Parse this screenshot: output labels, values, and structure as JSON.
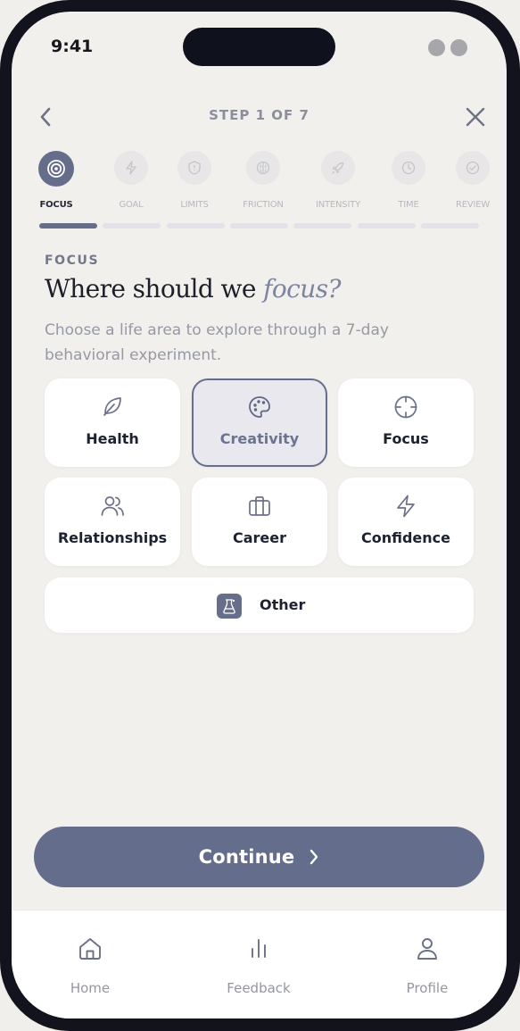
{
  "status_bar": {
    "time": "9:41"
  },
  "header": {
    "step_title": "STEP 1 OF 7"
  },
  "stepper": {
    "steps": [
      {
        "label": "FOCUS",
        "icon": "target-icon",
        "active": true
      },
      {
        "label": "GOAL",
        "icon": "bolt-icon",
        "active": false
      },
      {
        "label": "LIMITS",
        "icon": "shield-icon",
        "active": false
      },
      {
        "label": "FRICTION",
        "icon": "brain-icon",
        "active": false
      },
      {
        "label": "INTENSITY",
        "icon": "rocket-icon",
        "active": false
      },
      {
        "label": "TIME",
        "icon": "clock-icon",
        "active": false
      },
      {
        "label": "REVIEW",
        "icon": "check-circle-icon",
        "active": false
      }
    ],
    "progress": "1 of 7"
  },
  "content": {
    "eyebrow": "FOCUS",
    "heading_plain": "Where should we ",
    "heading_emphasis": "focus?",
    "subtitle": "Choose a life area to explore through a 7-day behavioral experiment."
  },
  "options": [
    {
      "label": "Health",
      "icon": "leaf-icon",
      "selected": false
    },
    {
      "label": "Creativity",
      "icon": "palette-icon",
      "selected": true
    },
    {
      "label": "Focus",
      "icon": "crosshair-icon",
      "selected": false
    },
    {
      "label": "Relationships",
      "icon": "users-icon",
      "selected": false
    },
    {
      "label": "Career",
      "icon": "briefcase-icon",
      "selected": false
    },
    {
      "label": "Confidence",
      "icon": "bolt-icon",
      "selected": false
    }
  ],
  "other_option": {
    "label": "Other",
    "icon": "flask-icon"
  },
  "primary_action": {
    "label": "Continue"
  },
  "tab_bar": {
    "items": [
      {
        "label": "Home",
        "icon": "home-icon"
      },
      {
        "label": "Feedback",
        "icon": "bar-chart-icon"
      },
      {
        "label": "Profile",
        "icon": "user-icon"
      }
    ]
  },
  "colors": {
    "accent": "#646d8b",
    "background": "#f2f0ed",
    "text_primary": "#1e2130",
    "text_muted": "#9699a5"
  }
}
